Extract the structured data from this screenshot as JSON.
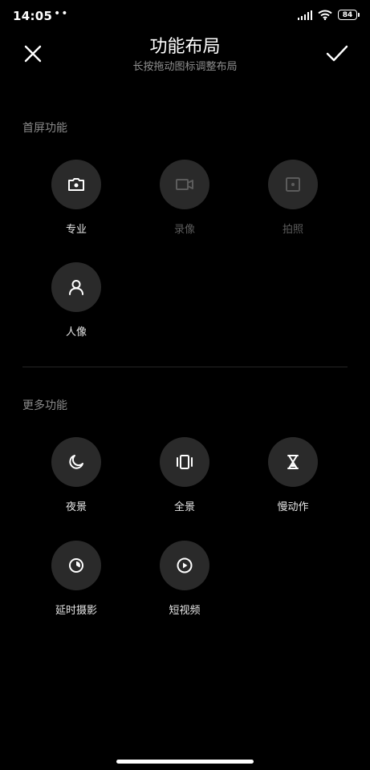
{
  "status_bar": {
    "time": "14:05",
    "dots": "••",
    "battery": "84"
  },
  "header": {
    "title": "功能布局",
    "subtitle": "长按拖动图标调整布局"
  },
  "home_section": {
    "title": "首屏功能",
    "items": [
      {
        "label": "专业",
        "icon": "camera-icon",
        "enabled": true
      },
      {
        "label": "录像",
        "icon": "video-icon",
        "enabled": false
      },
      {
        "label": "拍照",
        "icon": "photo-icon",
        "enabled": false
      },
      {
        "label": "人像",
        "icon": "portrait-icon",
        "enabled": true
      }
    ]
  },
  "more_section": {
    "title": "更多功能",
    "items": [
      {
        "label": "夜景",
        "icon": "moon-icon"
      },
      {
        "label": "全景",
        "icon": "panorama-icon"
      },
      {
        "label": "慢动作",
        "icon": "hourglass-icon"
      },
      {
        "label": "延时摄影",
        "icon": "timelapse-icon"
      },
      {
        "label": "短视频",
        "icon": "play-icon"
      }
    ]
  },
  "colors": {
    "background": "#000000",
    "circle": "#2a2a2a",
    "muted": "#8a8a8a",
    "disabled": "#5c5c5c"
  }
}
